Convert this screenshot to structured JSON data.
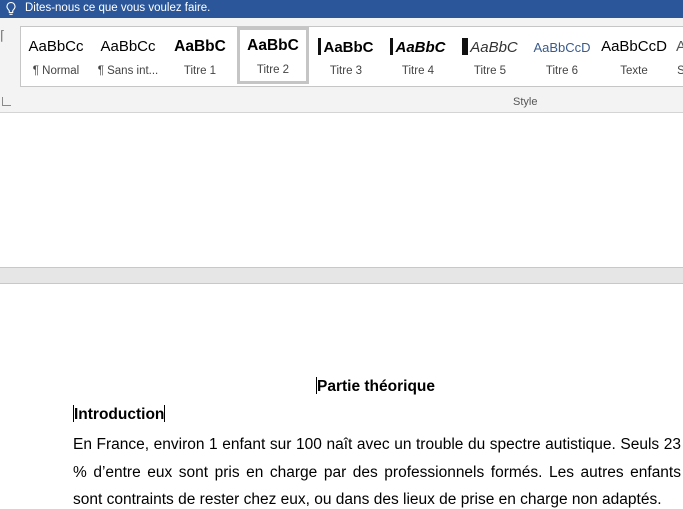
{
  "tell_me": {
    "text": "Dites-nous ce que vous voulez faire."
  },
  "ribbon": {
    "group_label": "Style",
    "styles": [
      {
        "preview": "AaBbCc",
        "label": "¶ Normal"
      },
      {
        "preview": "AaBbCc",
        "label": "¶ Sans int..."
      },
      {
        "preview": "AaBbC",
        "label": "Titre 1"
      },
      {
        "preview": "AaBbC",
        "label": "Titre 2"
      },
      {
        "preview": "AaBbC",
        "label": "Titre 3"
      },
      {
        "preview": "AaBbC",
        "label": "Titre 4"
      },
      {
        "preview": "AaBbC",
        "label": "Titre 5"
      },
      {
        "preview": "AaBbCcD",
        "label": "Titre 6"
      },
      {
        "preview": "AaBbCcD",
        "label": "Texte"
      },
      {
        "preview": "A",
        "label": "S"
      }
    ],
    "selected_style": "Titre 2"
  },
  "document": {
    "heading": "Partie théorique",
    "section_heading": "Introduction",
    "paragraph": "En France, environ 1 enfant sur 100 naît avec un trouble du spectre autistique. Seuls 23 % d’entre eux sont pris en charge par des professionnels formés. Les autres enfants sont contraints de rester chez eux, ou dans des lieux de prise en charge non adaptés."
  },
  "colors": {
    "title_bar": "#2b579a",
    "ribbon_bg": "#f3f3f3",
    "page_gap": "#e6e6e6"
  }
}
